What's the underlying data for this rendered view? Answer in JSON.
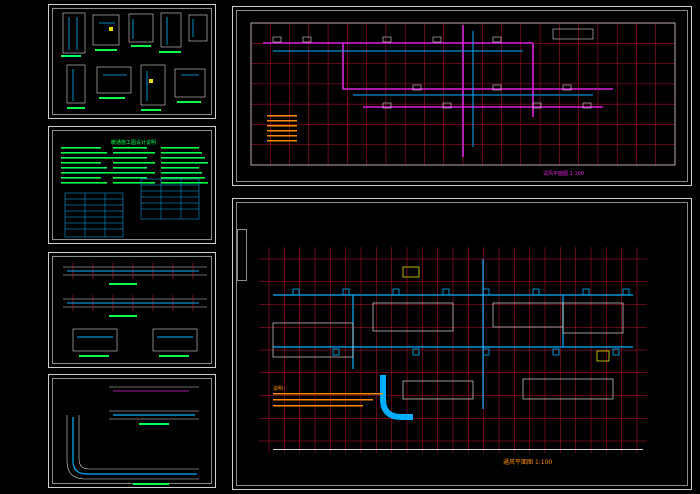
{
  "canvas": {
    "background": "#000000"
  },
  "sheets": [
    {
      "id": "details",
      "label": ""
    },
    {
      "id": "legend",
      "label": "",
      "legend_title": "暖通施工图设计说明"
    },
    {
      "id": "sections",
      "label": ""
    },
    {
      "id": "ramp",
      "label": ""
    },
    {
      "id": "ventilation-plan",
      "label": "",
      "plan_title": "试风平面图",
      "scale": "1:100"
    },
    {
      "id": "smoke-plan",
      "label": "",
      "plan_title": "通风平面图",
      "scale": "1:100",
      "notes_heading": "说明："
    }
  ],
  "colors": {
    "grid": "#c8102e",
    "duct": "#e020e0",
    "duct_alt": "#00b0ff",
    "text": "#00ff4c",
    "white": "#d8d8d8",
    "note": "#ff8c00",
    "yellow": "#e8e000"
  }
}
